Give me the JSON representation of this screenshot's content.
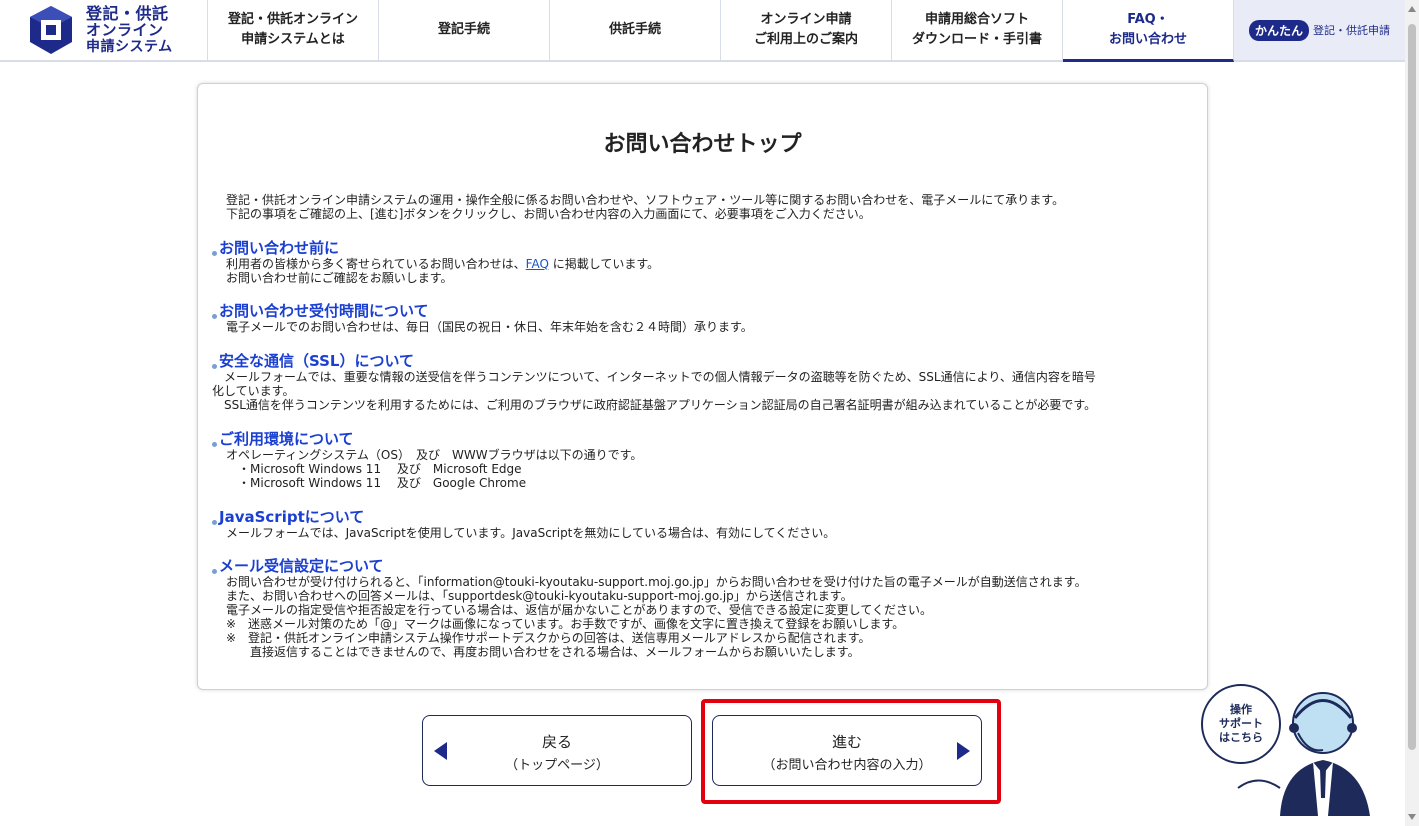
{
  "header": {
    "logo_lines": [
      "登記・供託",
      "オンライン",
      "申請システム"
    ],
    "nav": [
      {
        "label": "登記・供託オンライン\n申請システムとは"
      },
      {
        "label": "登記手続"
      },
      {
        "label": "供託手続"
      },
      {
        "label": "オンライン申請\nご利用上のご案内"
      },
      {
        "label": "申請用総合ソフト\nダウンロード・手引書"
      },
      {
        "label": "FAQ・\nお問い合わせ"
      }
    ],
    "kantan": {
      "badge": "かんたん",
      "text": "登記・供託申請"
    }
  },
  "main": {
    "title": "お問い合わせトップ",
    "intro": [
      "登記・供託オンライン申請システムの運用・操作全般に係るお問い合わせや、ソフトウェア・ツール等に関するお問い合わせを、電子メールにて承ります。",
      "下記の事項をご確認の上、[進む]ボタンをクリックし、お問い合わせ内容の入力画面にて、必要事項をご入力ください。"
    ],
    "sections": [
      {
        "title": "お問い合わせ前に",
        "pre": "利用者の皆様から多く寄せられているお問い合わせは、",
        "link": "FAQ",
        "post": " に掲載しています。",
        "line2": "お問い合わせ前にご確認をお願いします。"
      },
      {
        "title": "お問い合わせ受付時間について",
        "body": "電子メールでのお問い合わせは、毎日（国民の祝日・休日、年末年始を含む２４時間）承ります。"
      },
      {
        "title": "安全な通信（SSL）について",
        "body": "　メールフォームでは、重要な情報の送受信を伴うコンテンツについて、インターネットでの個人情報データの盗聴等を防ぐため、SSL通信により、通信内容を暗号\n化しています。\n　SSL通信を伴うコンテンツを利用するためには、ご利用のブラウザに政府認証基盤アプリケーション認証局の自己署名証明書が組み込まれていることが必要です。"
      },
      {
        "title": "ご利用環境について",
        "body": "オペレーティングシステム（OS）　及び　WWWブラウザは以下の通りです。\n　・Microsoft Windows 11　 及び　Microsoft Edge\n　・Microsoft Windows 11　 及び　Google Chrome"
      },
      {
        "title": "JavaScriptについて",
        "body": "メールフォームでは、JavaScriptを使用しています。JavaScriptを無効にしている場合は、有効にしてください。"
      },
      {
        "title": "メール受信設定について",
        "body": "お問い合わせが受け付けられると、「information@touki-kyoutaku-support.moj.go.jp」からお問い合わせを受け付けた旨の電子メールが自動送信されます。\nまた、お問い合わせへの回答メールは、「supportdesk@touki-kyoutaku-support-moj.go.jp」から送信されます。\n電子メールの指定受信や拒否設定を行っている場合は、返信が届かないことがありますので、受信できる設定に変更してください。\n※　迷惑メール対策のため「@」マークは画像になっています。お手数ですが、画像を文字に置き換えて登録をお願いします。\n※　登記・供託オンライン申請システム操作サポートデスクからの回答は、送信専用メールアドレスから配信されます。\n　　直接返信することはできませんので、再度お問い合わせをされる場合は、メールフォームからお願いいたします。"
      }
    ]
  },
  "buttons": {
    "back_label": "戻る",
    "back_sub": "（トップページ）",
    "next_label": "進む",
    "next_sub": "（お問い合わせ内容の入力）"
  },
  "support": {
    "bubble": "操作\nサポート\nはこちら"
  },
  "colors": {
    "brand": "#1d2a8a",
    "link": "#1a3fd1",
    "highlight": "#e3000f"
  }
}
